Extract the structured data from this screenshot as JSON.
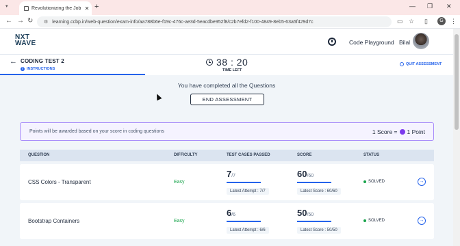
{
  "browser": {
    "tab_title": "Revolutionizing the Job Market",
    "url": "learning.ccbp.in/web-question/exam-info/aa788b6e-f19c-476c-ae3d-5eacdbe952f8/c2b7efd2-f100-4849-8eb5-63a5f429d7c",
    "profile_initial": "G"
  },
  "header": {
    "logo_top": "NXT",
    "logo_bottom": "WAVE",
    "code_playground": "Code Playground",
    "username": "Bilal"
  },
  "test": {
    "title": "CODING TEST 2",
    "instructions": "INSTRUCTIONS",
    "timer": "38 : 20",
    "time_left": "TIME LEFT",
    "quit": "QUIT ASSESSMENT"
  },
  "completion": {
    "message": "You have completed all the Questions",
    "end_button": "END ASSESSMENT"
  },
  "points": {
    "message": "Points will be awarded based on your score in coding questions",
    "score_prefix": "1 Score =",
    "score_suffix": "1 Point"
  },
  "table": {
    "headers": [
      "QUESTION",
      "DIFFICULTY",
      "TEST CASES PASSED",
      "SCORE",
      "STATUS"
    ],
    "rows": [
      {
        "question": "CSS Colors - Transparent",
        "difficulty": "Easy",
        "passed": "7",
        "total": "/7",
        "latest_attempt": "Latest Attempt : 7/7",
        "score": "60",
        "score_total": "/60",
        "latest_score": "Latest Score : 60/60",
        "status": "SOLVED"
      },
      {
        "question": "Bootstrap Containers",
        "difficulty": "Easy",
        "passed": "6",
        "total": "/6",
        "latest_attempt": "Latest Attempt : 6/6",
        "score": "50",
        "score_total": "/50",
        "latest_score": "Latest Score : 50/50",
        "status": "SOLVED"
      }
    ]
  },
  "colors": {
    "accent": "#2563eb",
    "easy": "#16a34a",
    "banner_border": "#a78bfa"
  }
}
